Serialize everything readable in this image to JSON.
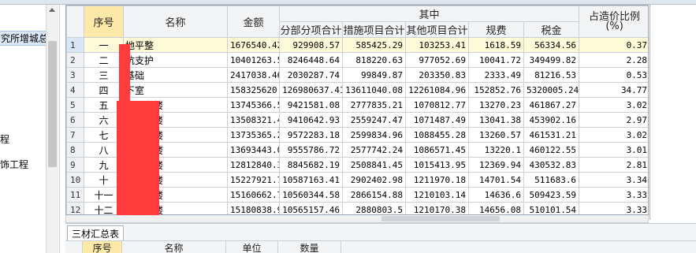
{
  "left_tree": {
    "items": [
      {
        "label": "究所增城总",
        "selected": true
      },
      {
        "label": "程"
      },
      {
        "label": "饰工程"
      }
    ]
  },
  "grid": {
    "headers": {
      "seq": "序号",
      "name": "名称",
      "amount": "金额",
      "group": "其中",
      "sub": [
        "分部分项合计",
        "措施项目合计",
        "其他项目合计",
        "规费",
        "税金"
      ],
      "ratio": "占造价比例\n(%)"
    },
    "rows": [
      {
        "n": "1",
        "seq": "一",
        "name": "地平整",
        "amount": "1676540.42",
        "a": "929908.57",
        "b": "585425.29",
        "c": "103253.41",
        "d": "1618.59",
        "e": "56334.56",
        "ratio": "0.37"
      },
      {
        "n": "2",
        "seq": "二",
        "name": "坑支护",
        "amount": "10401263.5",
        "a": "8246448.64",
        "b": "818220.63",
        "c": "977052.69",
        "d": "10041.72",
        "e": "349499.82",
        "ratio": "2.28"
      },
      {
        "n": "3",
        "seq": "三",
        "name": "基础",
        "amount": "2417038.46",
        "a": "2030287.74",
        "b": "99849.87",
        "c": "203350.83",
        "d": "2333.49",
        "e": "81216.53",
        "ratio": "0.53"
      },
      {
        "n": "4",
        "seq": "四",
        "name": "下室",
        "amount": "158325620.",
        "a": "126980637.41",
        "b": "13611040.08",
        "c": "12261084.96",
        "d": "152852.76",
        "e": "5320005.24",
        "ratio": "34.77"
      },
      {
        "n": "5",
        "seq": "五",
        "name": "座住宅楼",
        "amount": "13745366.5",
        "a": "9421581.08",
        "b": "2777835.21",
        "c": "1070812.77",
        "d": "13270.23",
        "e": "461867.27",
        "ratio": "3.02"
      },
      {
        "n": "6",
        "seq": "六",
        "name": "座住宅楼",
        "amount": "13508321.4",
        "a": "9410642.93",
        "b": "2559247.47",
        "c": "1071487.49",
        "d": "13041.38",
        "e": "453902.16",
        "ratio": "2.97"
      },
      {
        "n": "7",
        "seq": "七",
        "name": "座住宅楼",
        "amount": "13735365.2",
        "a": "9572283.18",
        "b": "2599834.96",
        "c": "1088455.28",
        "d": "13260.57",
        "e": "461531.21",
        "ratio": "3.02"
      },
      {
        "n": "8",
        "seq": "八",
        "name": "座住宅楼",
        "amount": "13693443.0",
        "a": "9555786.72",
        "b": "2577742.24",
        "c": "1086571.45",
        "d": "13220.1",
        "e": "460122.55",
        "ratio": "3.01"
      },
      {
        "n": "9",
        "seq": "九",
        "name": "座住宅楼",
        "amount": "12812840.3",
        "a": "8845682.19",
        "b": "2508841.45",
        "c": "1015413.95",
        "d": "12369.94",
        "e": "430532.83",
        "ratio": "2.81"
      },
      {
        "n": "10",
        "seq": "十",
        "name": "座住宅楼",
        "amount": "15227921.7",
        "a": "10587163.41",
        "b": "2902402.98",
        "c": "1211970.18",
        "d": "14701.54",
        "e": "511683.6",
        "ratio": "3.34"
      },
      {
        "n": "11",
        "seq": "十一",
        "name": "座住宅楼",
        "amount": "15160662.7",
        "a": "10560344.58",
        "b": "2866154.88",
        "c": "1210103.14",
        "d": "14636.6",
        "e": "509423.59",
        "ratio": "3.33"
      },
      {
        "n": "12",
        "seq": "十二",
        "name": "座住宅楼",
        "amount": "15180838.9",
        "a": "10565157.46",
        "b": "2880803.5",
        "c": "1210170.38",
        "d": "14656.08",
        "e": "510101.54",
        "ratio": "3.33"
      }
    ]
  },
  "tabs": {
    "active": "三材汇总表"
  },
  "subgrid": {
    "headers": [
      "序号",
      "名称",
      "单位",
      "数量"
    ]
  }
}
